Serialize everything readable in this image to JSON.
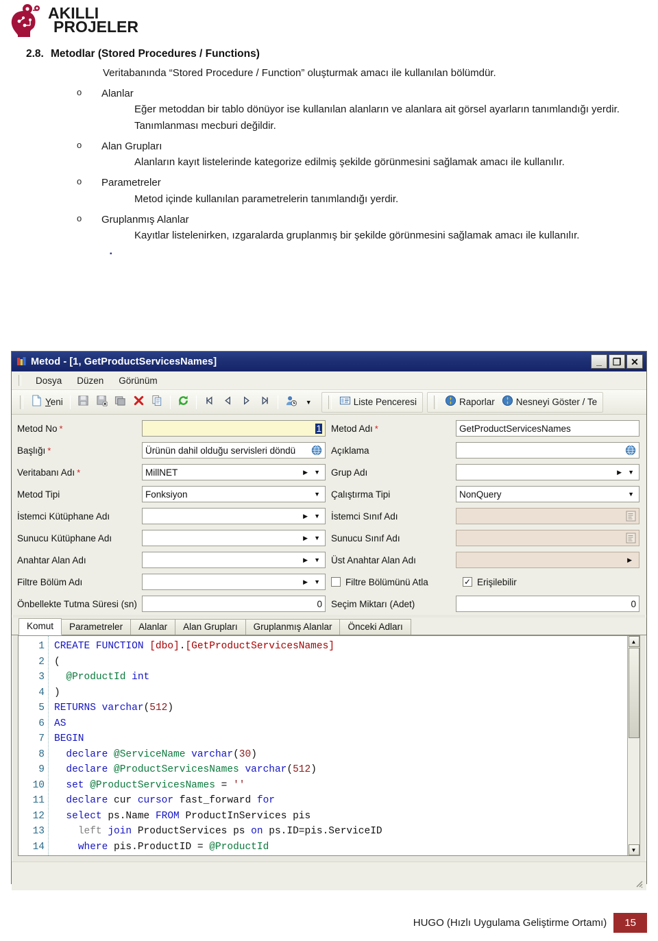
{
  "brand": {
    "line1": "AKILLI",
    "line2": "PROJELER",
    "color": "#a3123a"
  },
  "document": {
    "section_number": "2.8.",
    "section_title": "Metodlar (Stored Procedures / Functions)",
    "intro": "Veritabanında “Stored Procedure / Function” oluşturmak amacı ile kullanılan bölümdür.",
    "bullets": [
      {
        "marker": "o",
        "title": "Alanlar",
        "body": "Eğer metoddan bir tablo dönüyor ise kullanılan alanların ve alanlara ait görsel ayarların tanımlandığı yerdir. Tanımlanması mecburi değildir."
      },
      {
        "marker": "o",
        "title": "Alan Grupları",
        "body": "Alanların kayıt listelerinde kategorize edilmiş şekilde görünmesini sağlamak amacı ile kullanılır."
      },
      {
        "marker": "o",
        "title": "Parametreler",
        "body": "Metod içinde kullanılan parametrelerin tanımlandığı yerdir."
      },
      {
        "marker": "o",
        "title": "Gruplanmış Alanlar",
        "body": "Kayıtlar listelenirken, ızgaralarda gruplanmış bir şekilde görünmesini sağlamak amacı ile kullanılır."
      }
    ]
  },
  "app": {
    "title": "Metod - [1, GetProductServicesNames]",
    "window_buttons": {
      "minimize": "_",
      "maximize": "❐",
      "close": "✕"
    },
    "menu": [
      "Dosya",
      "Düzen",
      "Görünüm"
    ],
    "toolbar": {
      "new_label": "Yeni",
      "icons": [
        "new-icon",
        "save-icon",
        "save-close-icon",
        "save-copy-icon",
        "delete-icon",
        "copy-icon",
        "refresh-icon",
        "first-record-icon",
        "previous-record-icon",
        "next-record-icon",
        "last-record-icon",
        "user-history-icon",
        "dropdown-icon"
      ],
      "buttons": [
        {
          "label": "Liste Penceresi",
          "icon": "list-window-icon"
        },
        {
          "label": "Raporlar",
          "icon": "report-icon"
        },
        {
          "label": "Nesneyi Göster / Te",
          "icon": "show-object-icon"
        }
      ]
    },
    "form": {
      "rows": [
        {
          "left": {
            "label": "Metod No",
            "required": true,
            "value": "1",
            "type": "text-selected"
          },
          "right": {
            "label": "Metod Adı",
            "required": true,
            "value": "GetProductServicesNames",
            "type": "text"
          }
        },
        {
          "left": {
            "label": "Başlığı",
            "required": true,
            "value": "Ürünün dahil olduğu servisleri döndü",
            "type": "text-globe"
          },
          "right": {
            "label": "Açıklama",
            "required": false,
            "value": "",
            "type": "text-globe"
          }
        },
        {
          "left": {
            "label": "Veritabanı Adı",
            "required": true,
            "value": "MillNET",
            "type": "lookup"
          },
          "right": {
            "label": "Grup Adı",
            "required": false,
            "value": "",
            "type": "lookup"
          }
        },
        {
          "left": {
            "label": "Metod Tipi",
            "required": false,
            "value": "Fonksiyon",
            "type": "combo"
          },
          "right": {
            "label": "Çalıştırma Tipi",
            "required": false,
            "value": "NonQuery",
            "type": "combo"
          }
        },
        {
          "left": {
            "label": "İstemci Kütüphane Adı",
            "required": false,
            "value": "",
            "type": "lookup"
          },
          "right": {
            "label": "İstemci Sınıf Adı",
            "required": false,
            "value": "",
            "type": "notes-readonly"
          }
        },
        {
          "left": {
            "label": "Sunucu Kütüphane Adı",
            "required": false,
            "value": "",
            "type": "lookup"
          },
          "right": {
            "label": "Sunucu Sınıf Adı",
            "required": false,
            "value": "",
            "type": "notes-readonly"
          }
        },
        {
          "left": {
            "label": "Anahtar Alan Adı",
            "required": false,
            "value": "",
            "type": "lookup"
          },
          "right": {
            "label": "Üst Anahtar Alan Adı",
            "required": false,
            "value": "",
            "type": "readonly-arrow"
          }
        },
        {
          "left": {
            "label": "Filtre Bölüm Adı",
            "required": false,
            "value": "",
            "type": "lookup"
          },
          "right": {
            "label": "",
            "required": false,
            "value": "",
            "type": "checkbox-pair"
          }
        },
        {
          "left": {
            "label": "Önbellekte Tutma Süresi (sn)",
            "required": false,
            "value": "0",
            "type": "number"
          },
          "right": {
            "label": "Seçim Miktarı (Adet)",
            "required": false,
            "value": "0",
            "type": "number"
          }
        }
      ],
      "checkboxes": [
        {
          "label": "Filtre Bölümünü Atla",
          "checked": false
        },
        {
          "label": "Erişilebilir",
          "checked": true
        }
      ]
    },
    "tabs": [
      {
        "label": "Komut",
        "active": true
      },
      {
        "label": "Parametreler",
        "active": false
      },
      {
        "label": "Alanlar",
        "active": false
      },
      {
        "label": "Alan Grupları",
        "active": false
      },
      {
        "label": "Gruplanmış Alanlar",
        "active": false
      },
      {
        "label": "Önceki Adları",
        "active": false
      }
    ],
    "editor": {
      "line_numbers": [
        "1",
        "2",
        "3",
        "4",
        "5",
        "6",
        "7",
        "8",
        "9",
        "10",
        "11",
        "12",
        "13",
        "14"
      ],
      "lines": [
        "CREATE FUNCTION [dbo].[GetProductServicesNames]",
        "(",
        "  @ProductId int",
        ")",
        "RETURNS varchar(512)",
        "AS",
        "BEGIN",
        "  declare @ServiceName varchar(30)",
        "  declare @ProductServicesNames varchar(512)",
        "  set @ProductServicesNames = ''",
        "  declare cur cursor fast_forward for",
        "  select ps.Name FROM ProductInServices pis",
        "    left join ProductServices ps on ps.ID=pis.ServiceID",
        "    where pis.ProductID = @ProductId"
      ]
    }
  },
  "footer": {
    "text": "HUGO (Hızlı Uygulama Geliştirme Ortamı)",
    "page_number": "15",
    "accent": "#9e2b2b"
  }
}
